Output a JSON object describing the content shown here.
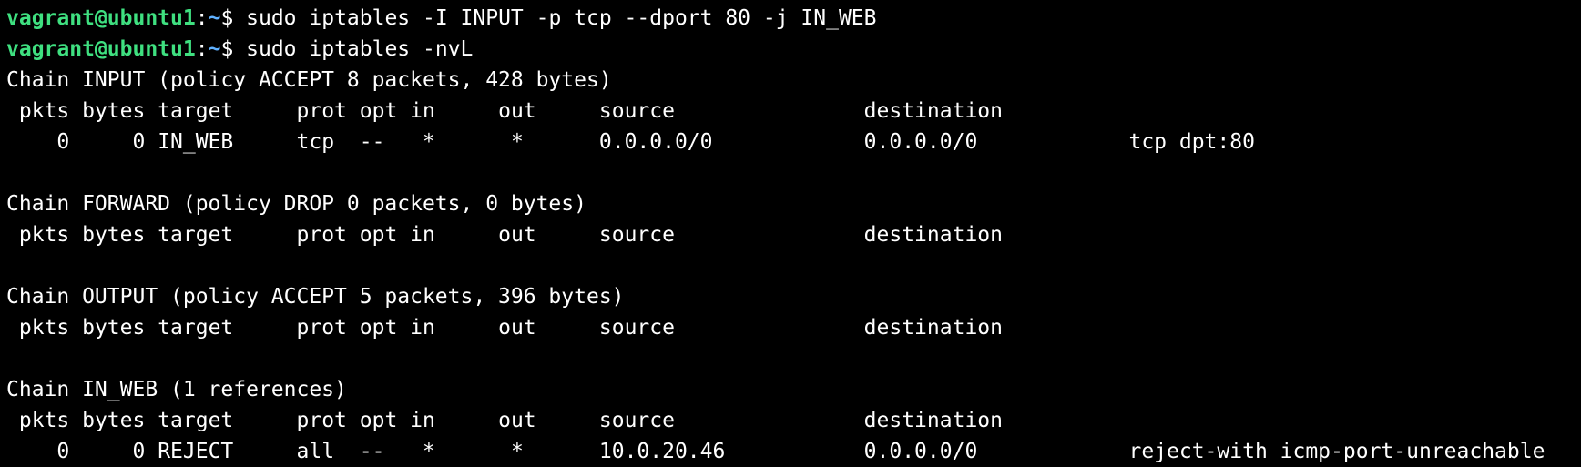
{
  "prompt": {
    "user_host": "vagrant@ubuntu1",
    "colon": ":",
    "path": "~",
    "symbol": "$ "
  },
  "commands": [
    "sudo iptables -I INPUT -p tcp --dport 80 -j IN_WEB",
    "sudo iptables -nvL"
  ],
  "header_columns": [
    "pkts",
    "bytes",
    "target",
    "prot",
    "opt",
    "in",
    "out",
    "source",
    "destination"
  ],
  "chains": [
    {
      "title": "Chain INPUT (policy ACCEPT 8 packets, 428 bytes)",
      "rules": [
        {
          "pkts": "0",
          "bytes": "0",
          "target": "IN_WEB",
          "prot": "tcp",
          "opt": "--",
          "in": "*",
          "out": "*",
          "source": "0.0.0.0/0",
          "destination": "0.0.0.0/0",
          "extra": "tcp dpt:80"
        }
      ]
    },
    {
      "title": "Chain FORWARD (policy DROP 0 packets, 0 bytes)",
      "rules": []
    },
    {
      "title": "Chain OUTPUT (policy ACCEPT 5 packets, 396 bytes)",
      "rules": []
    },
    {
      "title": "Chain IN_WEB (1 references)",
      "rules": [
        {
          "pkts": "0",
          "bytes": "0",
          "target": "REJECT",
          "prot": "all",
          "opt": "--",
          "in": "*",
          "out": "*",
          "source": "10.0.20.46",
          "destination": "0.0.0.0/0",
          "extra": "reject-with icmp-port-unreachable"
        }
      ]
    }
  ],
  "colors": {
    "background": "#000000",
    "foreground": "#ffffff",
    "user_host": "#3fe080",
    "path": "#5fb0ff"
  }
}
